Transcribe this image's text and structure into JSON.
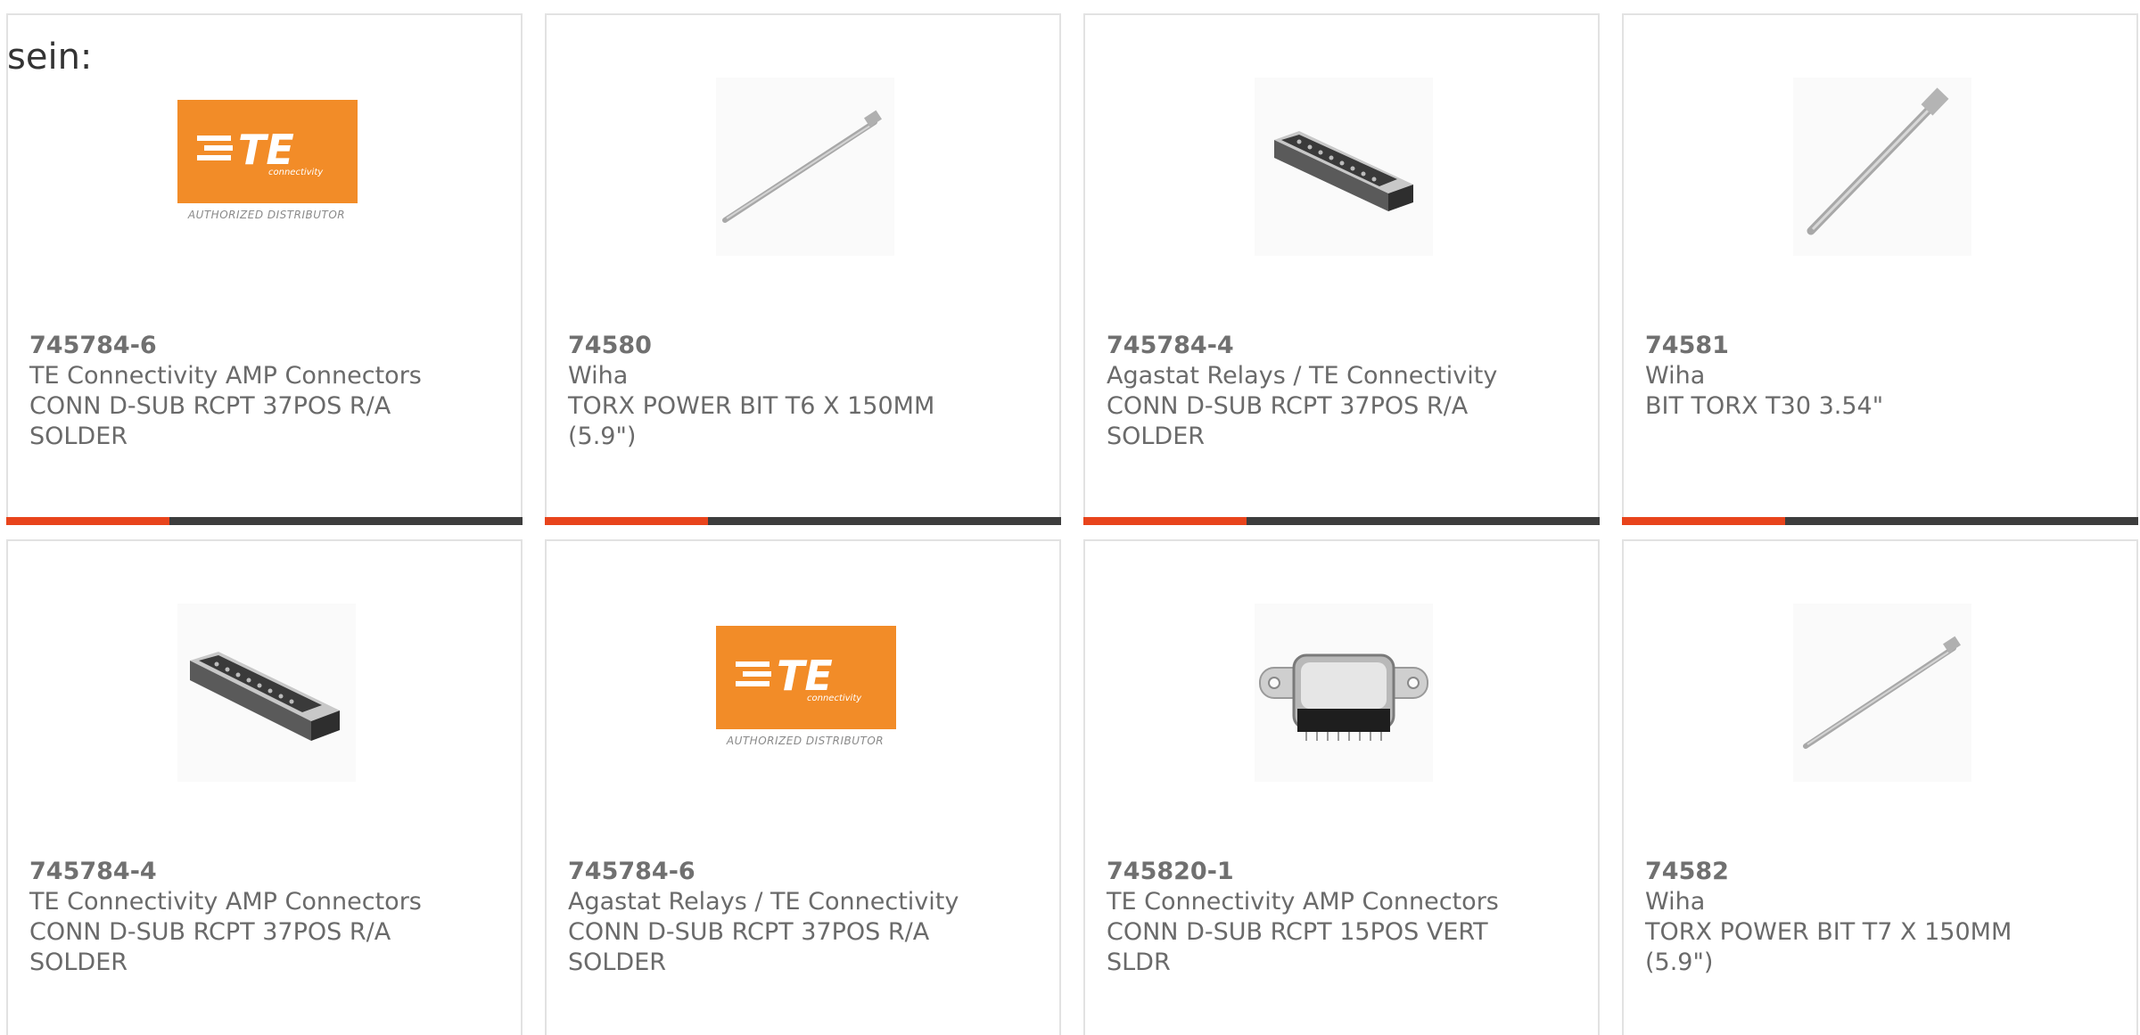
{
  "intro_text": "sein:",
  "colors": {
    "accent": "#e8441c",
    "bar_dark": "#3d3d3d",
    "card_border": "#e2e2e2",
    "te_orange": "#f28c28"
  },
  "te_logo": {
    "wordmark": "TE",
    "tagline": "connectivity",
    "caption": "AUTHORIZED DISTRIBUTOR"
  },
  "products": [
    {
      "part_number": "745784-6",
      "manufacturer": "TE Connectivity AMP Connectors",
      "desc_line1": "CONN D-SUB RCPT 37POS R/A",
      "desc_line2": "SOLDER",
      "image": "te-logo"
    },
    {
      "part_number": "74580",
      "manufacturer": "Wiha",
      "desc_line1": "TORX POWER BIT T6 X 150MM",
      "desc_line2": "(5.9\")",
      "image": "torx-bit"
    },
    {
      "part_number": "745784-4",
      "manufacturer": "Agastat Relays / TE Connectivity",
      "desc_line1": "CONN D-SUB RCPT 37POS R/A",
      "desc_line2": "SOLDER",
      "image": "dsub-connector"
    },
    {
      "part_number": "74581",
      "manufacturer": "Wiha",
      "desc_line1": "BIT TORX T30 3.54\"",
      "desc_line2": "",
      "image": "torx-bit-short"
    },
    {
      "part_number": "745784-4",
      "manufacturer": "TE Connectivity AMP Connectors",
      "desc_line1": "CONN D-SUB RCPT 37POS R/A",
      "desc_line2": "SOLDER",
      "image": "dsub-connector"
    },
    {
      "part_number": "745784-6",
      "manufacturer": "Agastat Relays / TE Connectivity",
      "desc_line1": "CONN D-SUB RCPT 37POS R/A",
      "desc_line2": "SOLDER",
      "image": "te-logo"
    },
    {
      "part_number": "745820-1",
      "manufacturer": "TE Connectivity AMP Connectors",
      "desc_line1": "CONN D-SUB RCPT 15POS VERT",
      "desc_line2": "SLDR",
      "image": "dsub-vertical"
    },
    {
      "part_number": "74582",
      "manufacturer": "Wiha",
      "desc_line1": "TORX POWER BIT T7 X 150MM",
      "desc_line2": "(5.9\")",
      "image": "torx-bit"
    }
  ]
}
